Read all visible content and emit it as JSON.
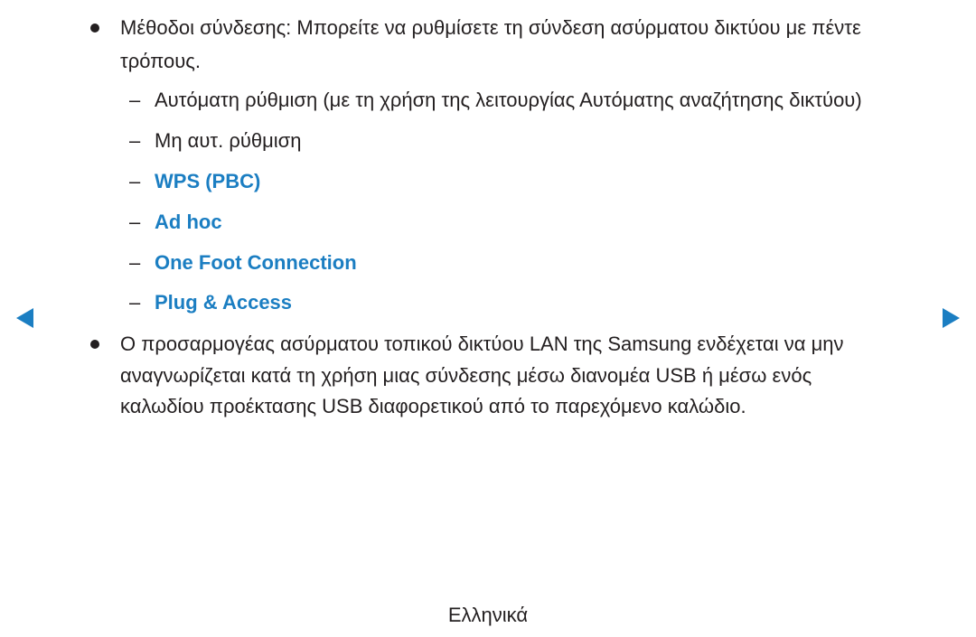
{
  "bullet1": {
    "line1": "Μέθοδοι σύνδεσης: Μπορείτε να ρυθμίσετε τη σύνδεση ασύρματου δικτύου με πέντε",
    "line2": "τρόπους."
  },
  "methods": [
    {
      "label": "Αυτόματη ρύθμιση (με τη χρήση της λειτουργίας Αυτόματης αναζήτησης δικτύου)",
      "link": false
    },
    {
      "label": "Μη αυτ. ρύθμιση",
      "link": false
    },
    {
      "label": "WPS (PBC)",
      "link": true
    },
    {
      "label": "Ad hoc",
      "link": true
    },
    {
      "label": "One Foot Connection",
      "link": true
    },
    {
      "label": "Plug & Access",
      "link": true
    }
  ],
  "dash_glyph": "–",
  "bullet2": {
    "line1": "Ο προσαρμογέας ασύρματου τοπικού δικτύου LAN της Samsung ενδέχεται να μην",
    "line2": "αναγνωρίζεται κατά τη χρήση μιας σύνδεσης μέσω διανομέα USB ή μέσω ενός",
    "line3": "καλωδίου προέκτασης USB διαφορετικού από το παρεχόμενο καλώδιο."
  },
  "navigation": {
    "prev_icon": "triangle-left",
    "next_icon": "triangle-right"
  },
  "footer": {
    "language": "Ελληνικά"
  },
  "colors": {
    "text": "#231f20",
    "link": "#1b7ec2"
  }
}
